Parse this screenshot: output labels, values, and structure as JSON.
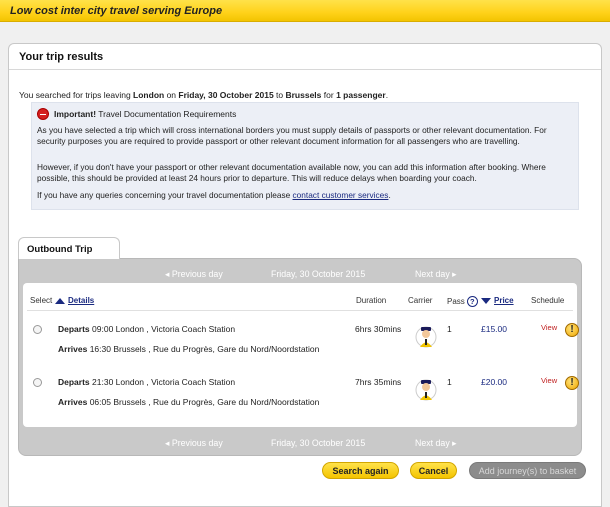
{
  "banner": {
    "title": "Low cost inter city travel serving Europe"
  },
  "page": {
    "title": "Your trip results"
  },
  "search": {
    "prefix": "You searched for trips leaving ",
    "origin": "London",
    "on": " on ",
    "date": "Friday, 30 October 2015",
    "to": " to ",
    "destination": "Brussels",
    "for": " for ",
    "passengers": "1 passenger",
    "suffix": "."
  },
  "notice": {
    "title": "Important!",
    "subtitle": " Travel Documentation Requirements",
    "para1": "As you have selected a trip which will cross international borders you must supply details of passports or other relevant documentation. For security purposes you are required to provide passport or other relevant document information for all passengers who are travelling.",
    "para2": "However, if you don't have your passport or other relevant documentation available now, you can add this information after booking. Where possible, this should be provided at least 24 hours prior to departure. This will reduce delays when boarding your coach.",
    "para3_prefix": "If you have any queries concerning your travel documentation please ",
    "para3_link": "contact customer services",
    "para3_suffix": "."
  },
  "outbound": {
    "tab_label": "Outbound Trip",
    "prev_day": "◂  Previous day",
    "current_day": "Friday, 30 October 2015",
    "next_day": "Next day  ▸",
    "headers": {
      "select": "Select",
      "details": "Details",
      "duration": "Duration",
      "carrier": "Carrier",
      "pass": "Pass",
      "price": "Price",
      "schedule": "Schedule"
    },
    "trips": [
      {
        "depart_label": "Departs",
        "depart_time": "09:00",
        "depart_place": " London , Victoria Coach Station",
        "arrive_label": "Arrives",
        "arrive_time": "16:30",
        "arrive_place": " Brussels , Rue du Progrès, Gare du Nord/Noordstation",
        "duration": "6hrs 30mins",
        "passengers": "1",
        "price": "£15.00",
        "schedule_link": "View"
      },
      {
        "depart_label": "Departs",
        "depart_time": "21:30",
        "depart_place": " London , Victoria Coach Station",
        "arrive_label": "Arrives",
        "arrive_time": "06:05",
        "arrive_place": " Brussels , Rue du Progrès, Gare du Nord/Noordstation",
        "duration": "7hrs 35mins",
        "passengers": "1",
        "price": "£20.00",
        "schedule_link": "View"
      }
    ]
  },
  "buttons": {
    "search_again": "Search again",
    "cancel": "Cancel",
    "add_to_basket": "Add journey(s) to basket"
  },
  "icons": {
    "stop": "stop-icon",
    "help": "help-icon",
    "warning": "warning-icon",
    "carrier": "coach-driver-icon",
    "sort_up": "triangle-up-icon",
    "sort_down": "triangle-down-icon"
  },
  "colors": {
    "banner": "#ffd21a",
    "link": "#1a2a80",
    "alert": "#c02020",
    "panel": "#c9c9c9"
  }
}
